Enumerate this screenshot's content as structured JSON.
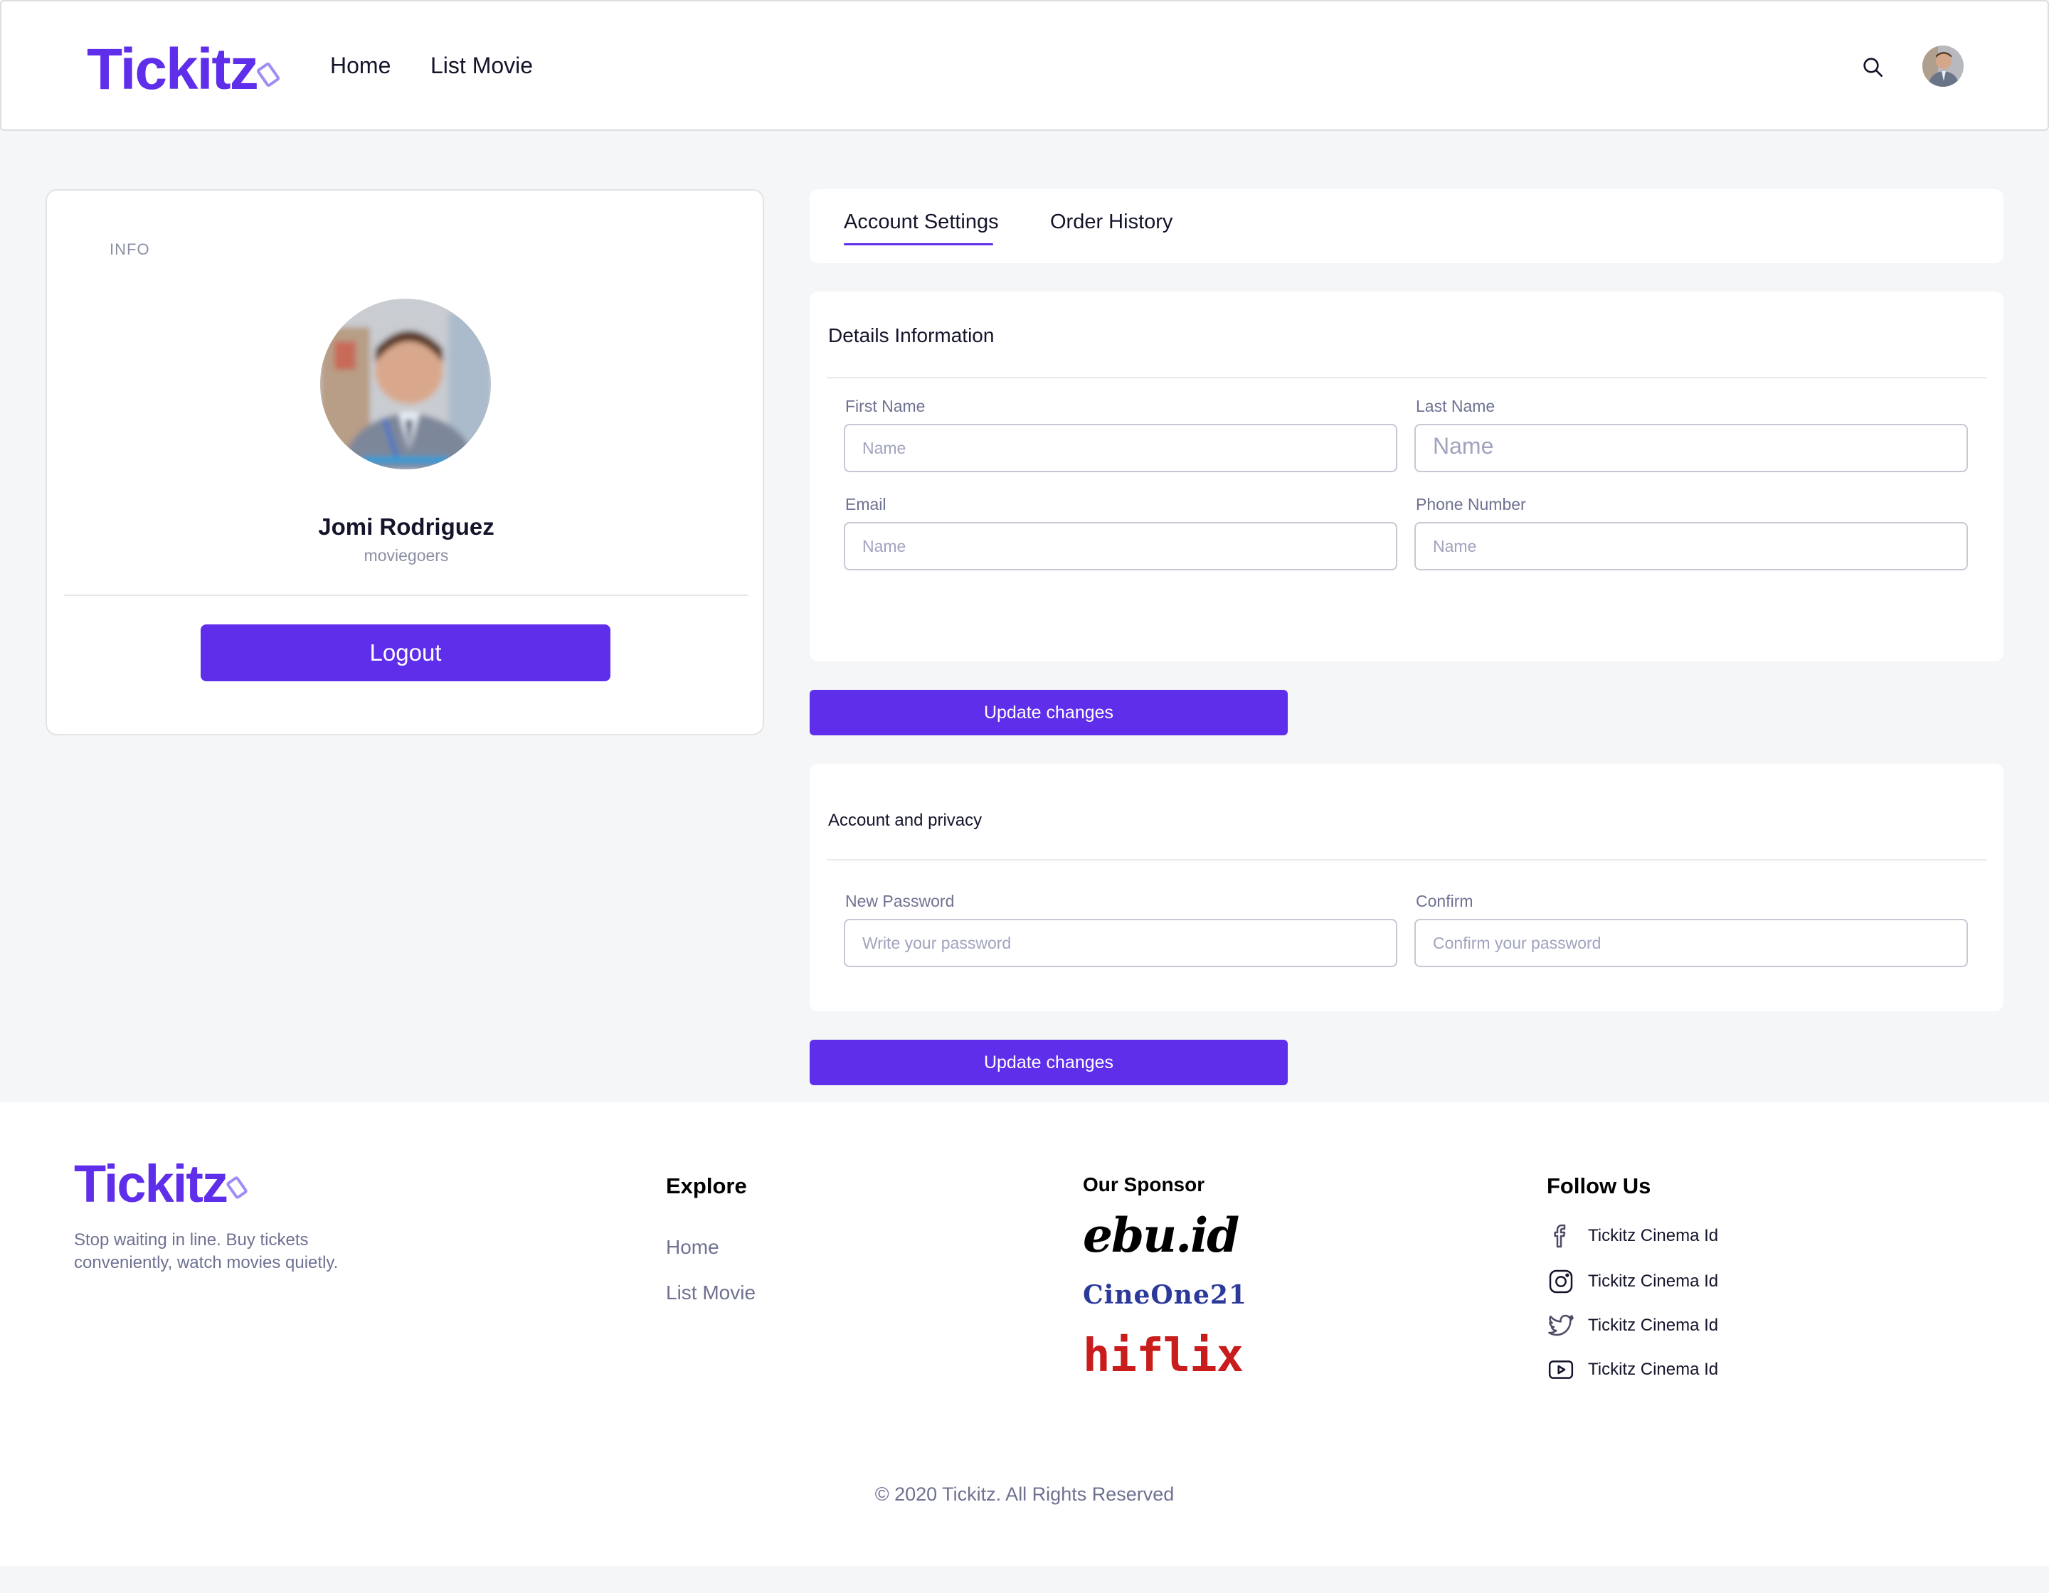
{
  "brand": {
    "name": "Tickitz",
    "color": "#5f2eea"
  },
  "nav": {
    "home": "Home",
    "list_movie": "List Movie"
  },
  "header_icons": {
    "search": "search-icon",
    "avatar": "user-avatar"
  },
  "info_card": {
    "label": "INFO",
    "name": "Jomi Rodriguez",
    "role": "moviegoers",
    "logout_label": "Logout"
  },
  "tabs": [
    {
      "label": "Account Settings",
      "active": true
    },
    {
      "label": "Order History",
      "active": false
    }
  ],
  "details": {
    "title": "Details Information",
    "first_name_label": "First Name",
    "first_name_placeholder": "Name",
    "last_name_label": "Last Name",
    "last_name_placeholder": "Name",
    "email_label": "Email",
    "email_placeholder": "Name",
    "phone_label": "Phone Number",
    "phone_placeholder": "Name",
    "update_label": "Update changes"
  },
  "privacy": {
    "title": "Account and privacy",
    "new_password_label": "New Password",
    "new_password_placeholder": "Write your password",
    "confirm_label": "Confirm",
    "confirm_placeholder": "Confirm your password",
    "update_label": "Update changes"
  },
  "footer": {
    "tagline": "Stop waiting in line. Buy tickets conveniently, watch movies quietly.",
    "explore_heading": "Explore",
    "explore_links": [
      "Home",
      "List Movie"
    ],
    "sponsor_heading": "Our Sponsor",
    "sponsors": [
      "ebu.id",
      "CineOne21",
      "hiflix"
    ],
    "follow_heading": "Follow Us",
    "socials": [
      {
        "icon": "facebook-icon",
        "label": "Tickitz Cinema Id"
      },
      {
        "icon": "instagram-icon",
        "label": "Tickitz Cinema Id"
      },
      {
        "icon": "twitter-icon",
        "label": "Tickitz Cinema Id"
      },
      {
        "icon": "youtube-icon",
        "label": "Tickitz Cinema Id"
      }
    ],
    "copyright": "© 2020 Tickitz. All Rights Reserved"
  }
}
